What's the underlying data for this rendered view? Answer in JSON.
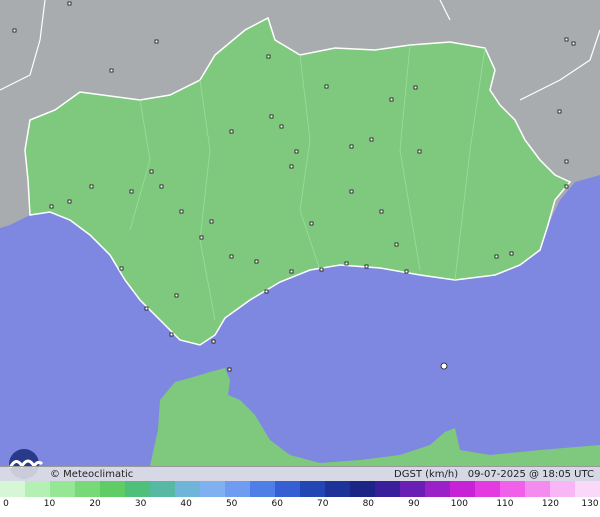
{
  "branding": {
    "copyright_name": "© Meteoclimatic"
  },
  "info": {
    "variable": "DGST (km/h)",
    "datetime": "09-07-2025 @ 18:05 UTC"
  },
  "colors": {
    "sea": "#7f88e0",
    "land_outside": "#a9acaf",
    "region_fill": "#7ec97e",
    "border": "#ffffff"
  },
  "legend": {
    "tick_labels": [
      "0",
      "10",
      "20",
      "30",
      "40",
      "50",
      "60",
      "70",
      "80",
      "90",
      "100",
      "110",
      "120",
      "130"
    ],
    "colors": [
      "#d6f7d6",
      "#b4f0b4",
      "#95e695",
      "#78d978",
      "#5fcc66",
      "#4fc07a",
      "#57b9a4",
      "#6eb5d8",
      "#7fb0f0",
      "#6f9cf0",
      "#4e7fe6",
      "#355fd2",
      "#2246b4",
      "#1e3398",
      "#1b2585",
      "#3a1f9a",
      "#6a1fb4",
      "#9a20c8",
      "#c822d6",
      "#e43be0",
      "#f060e8",
      "#f48cf0",
      "#f8b6f6",
      "#fad8fa"
    ]
  }
}
